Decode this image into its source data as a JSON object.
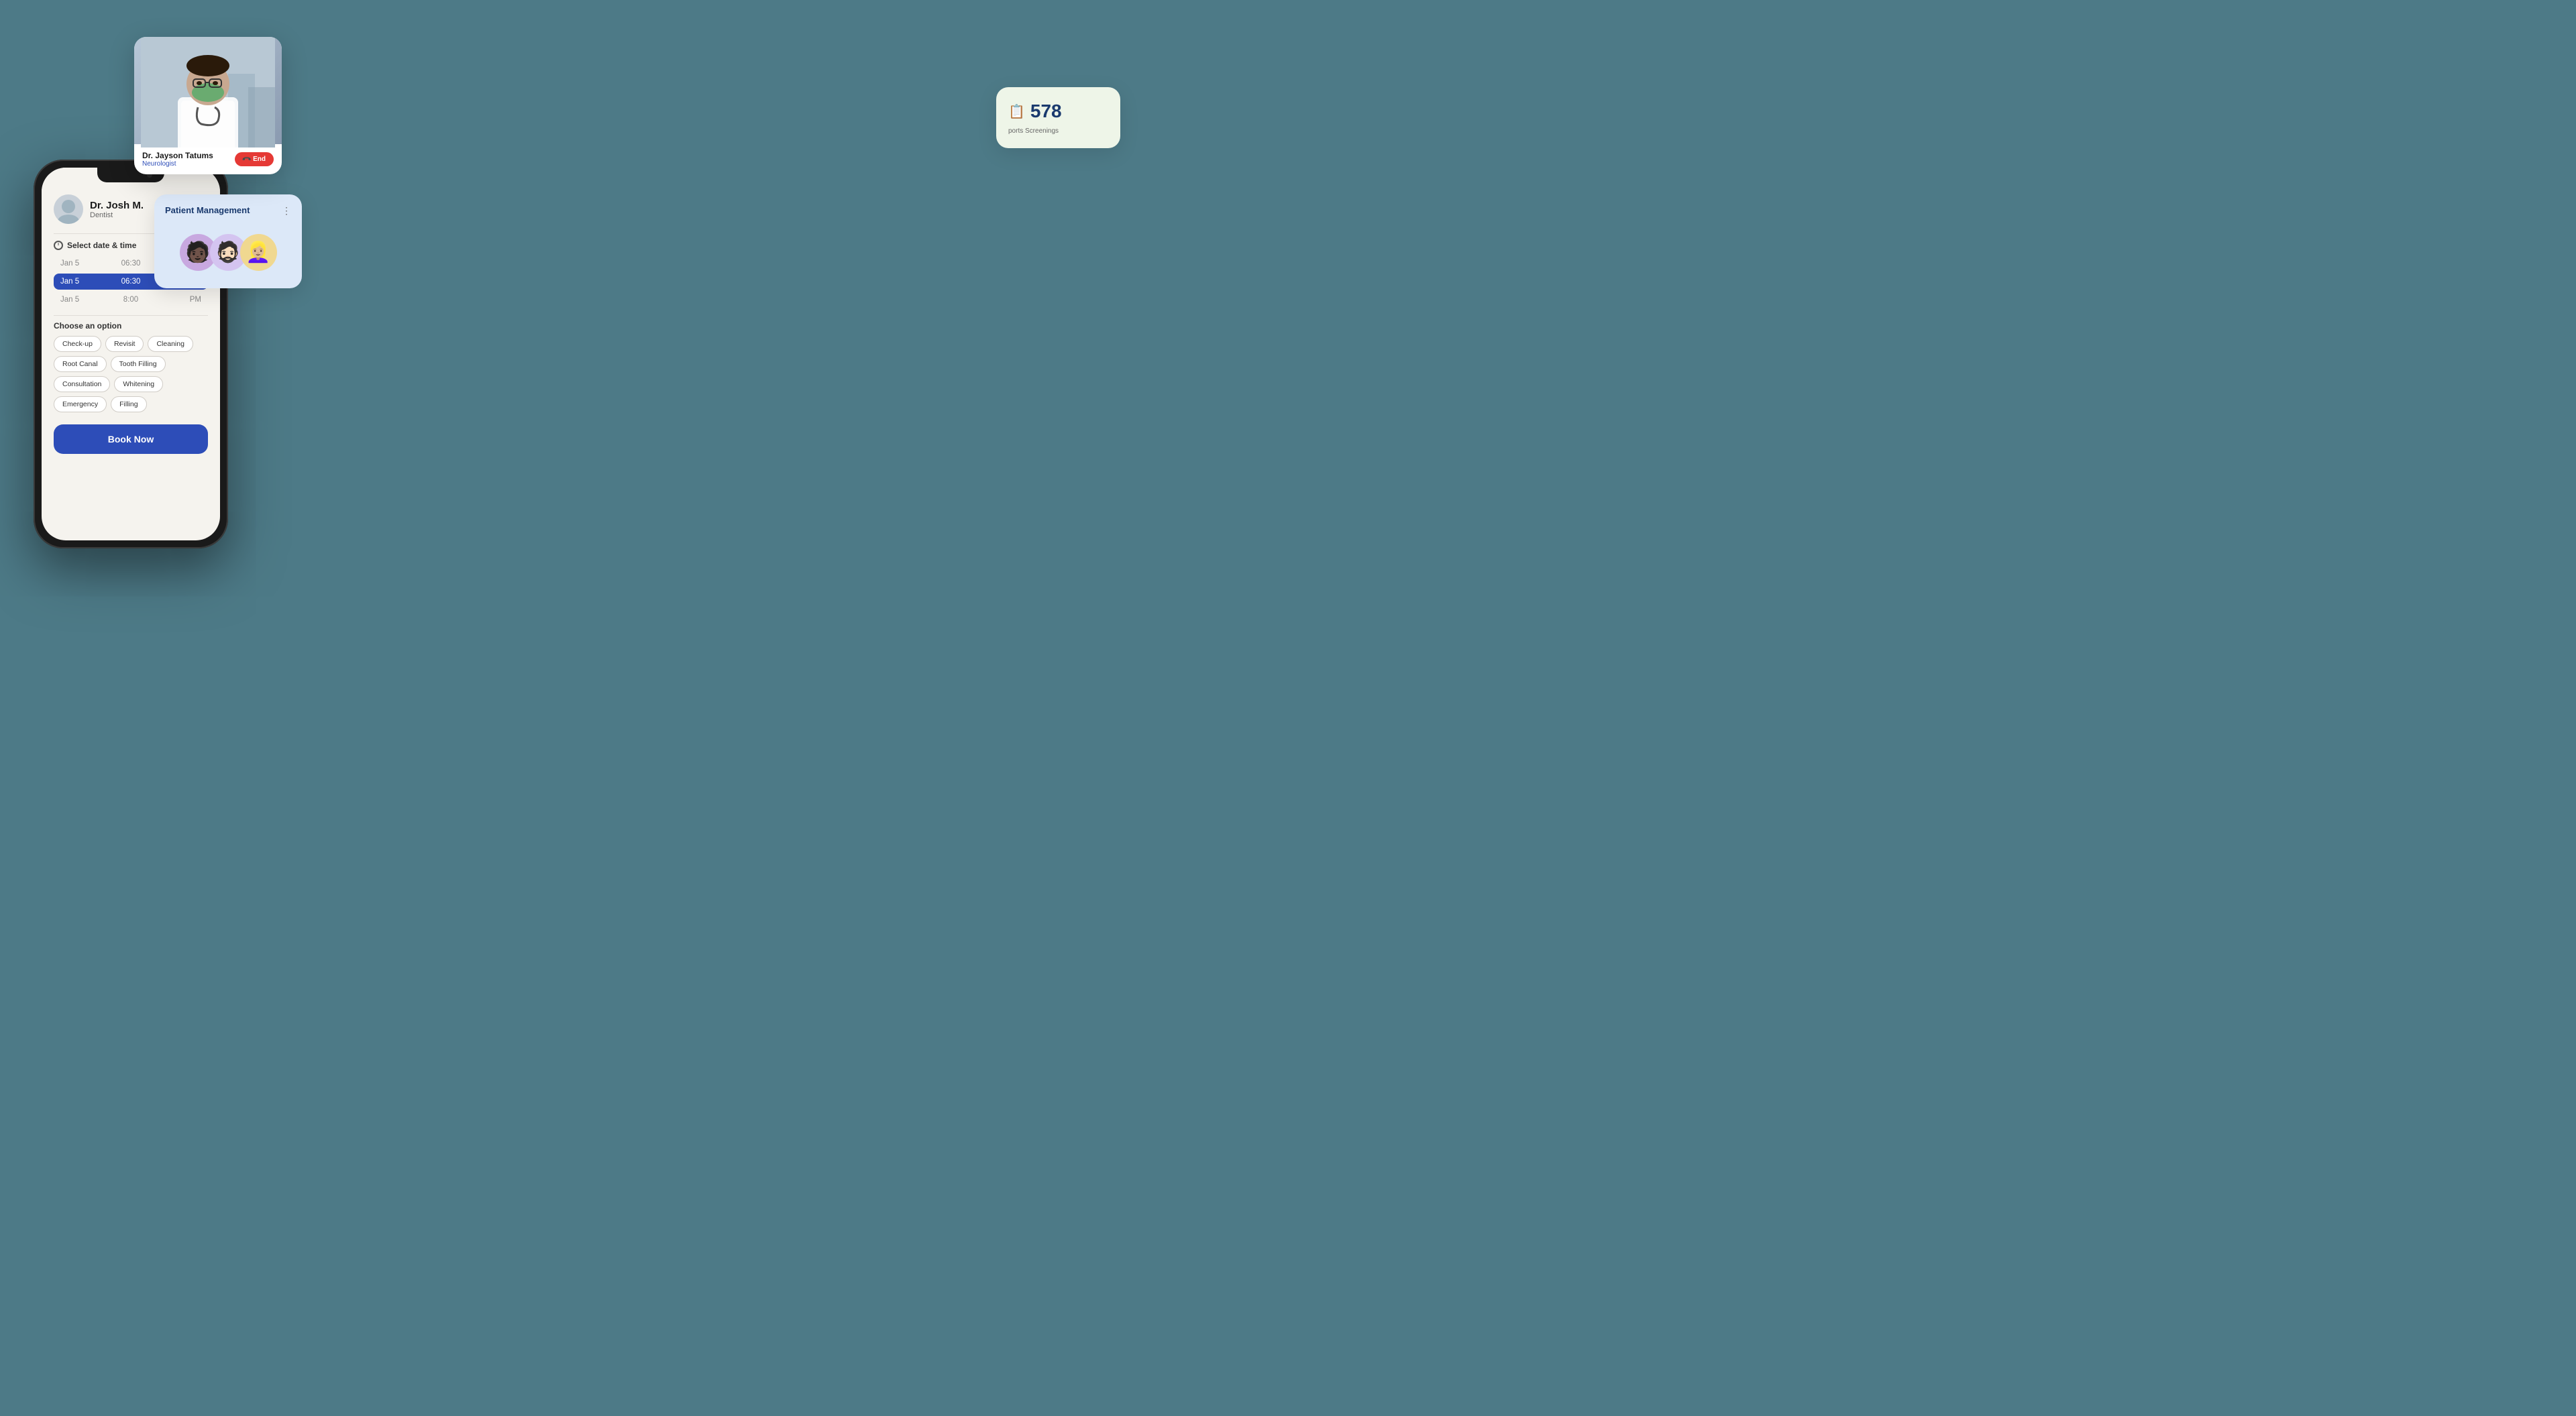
{
  "phone": {
    "doctor": {
      "name": "Dr. Josh M.",
      "specialty": "Dentist",
      "avatar_emoji": "👨‍⚕️"
    },
    "datetime": {
      "label": "Select date & time",
      "rows": [
        {
          "date": "Jan 5",
          "time": "06:30",
          "period": "PM",
          "active": false
        },
        {
          "date": "Jan 5",
          "time": "06:30",
          "period": "PM",
          "active": true
        },
        {
          "date": "Jan 5",
          "time": "8:00",
          "period": "PM",
          "active": false
        }
      ]
    },
    "options": {
      "title": "Choose an option",
      "items": [
        "Check-up",
        "Revisit",
        "Cleaning",
        "Root Canal",
        "Tooth Filling",
        "Consultation",
        "Whitening",
        "Emergency",
        "Filling"
      ]
    },
    "book_button": "Book Now"
  },
  "video_card": {
    "doctor_name": "Dr. Jayson Tatums",
    "specialty": "Neurologist",
    "end_label": "End"
  },
  "patient_mgmt": {
    "title": "Patient Management",
    "avatars": [
      "🧑🏿",
      "🧔🏻",
      "👱🏼‍♀️"
    ]
  },
  "stats": {
    "number": "578",
    "label": "ports Screenings",
    "icon": "📋"
  }
}
